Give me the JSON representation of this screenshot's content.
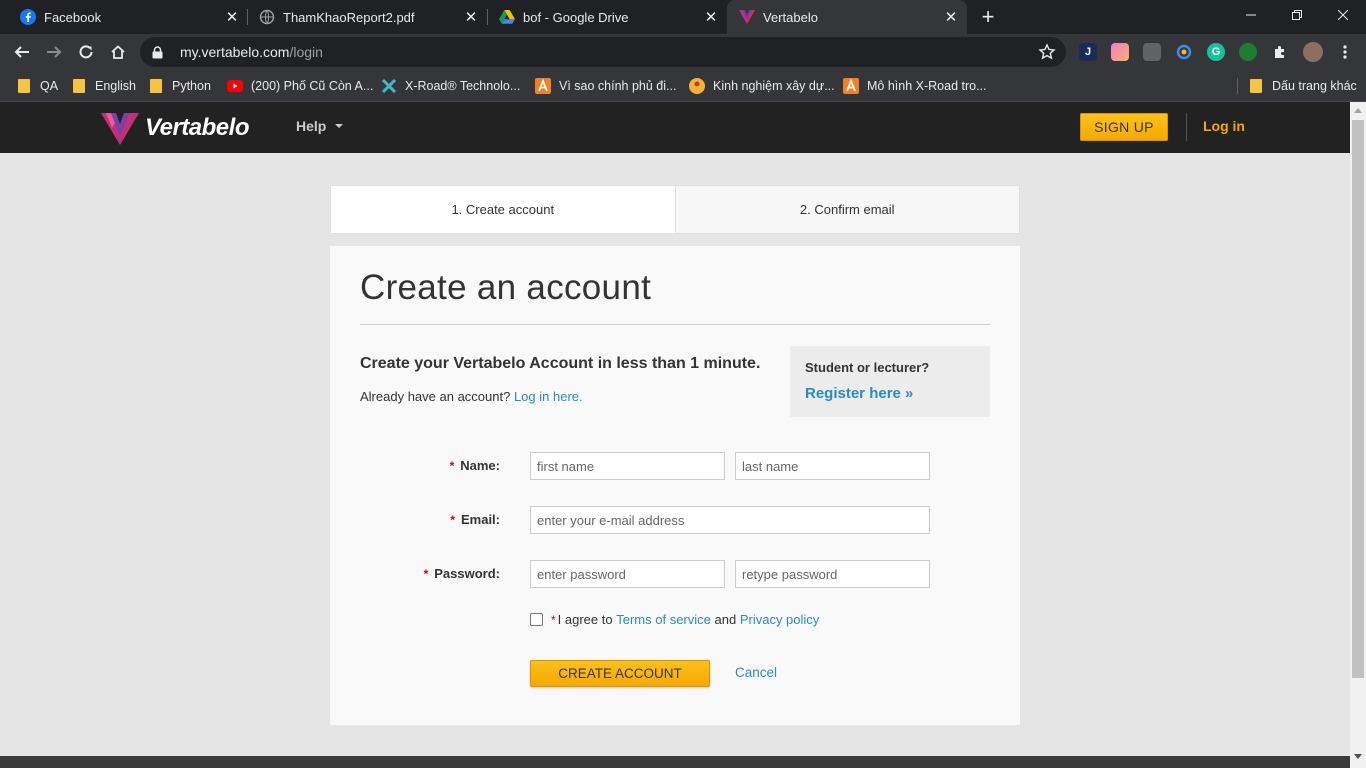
{
  "browser": {
    "tabs": [
      {
        "title": "Facebook",
        "icon": "facebook-icon",
        "close": "✕"
      },
      {
        "title": "ThamKhaoReport2.pdf",
        "icon": "globe-icon",
        "close": "✕"
      },
      {
        "title": "bof - Google Drive",
        "icon": "google-drive-icon",
        "close": "✕"
      },
      {
        "title": "Vertabelo",
        "icon": "vertabelo-icon",
        "close": "✕"
      }
    ],
    "new_tab": "+",
    "url_host": "my.vertabelo.com",
    "url_path": "/login",
    "bookmarks": [
      {
        "label": "QA",
        "icon": "folder-icon"
      },
      {
        "label": "English",
        "icon": "folder-icon"
      },
      {
        "label": "Python",
        "icon": "folder-icon"
      },
      {
        "label": "(200) Phố Cũ Còn A...",
        "icon": "youtube-icon"
      },
      {
        "label": "X-Road® Technolo...",
        "icon": "xroad-icon"
      },
      {
        "label": "Vì sao chính phủ đi...",
        "icon": "a-letter-icon"
      },
      {
        "label": "Kinh nghiệm xây dự...",
        "icon": "profile-icon"
      },
      {
        "label": "Mô hình X-Road tro...",
        "icon": "a-letter-icon"
      },
      {
        "label": "Dấu trang khác",
        "icon": "folder-icon"
      }
    ]
  },
  "site": {
    "logo_text": "Vertabelo",
    "help_label": "Help",
    "signup_label": "SIGN UP",
    "login_label": "Log in"
  },
  "steps": [
    "1. Create account",
    "2. Confirm email"
  ],
  "form": {
    "title": "Create an account",
    "lead": "Create your Vertabelo Account in less than 1 minute.",
    "already_text": "Already have an account?",
    "already_link": "Log in here.",
    "student_question": "Student or lecturer?",
    "student_link": "Register here »",
    "required_mark": "*",
    "name_label": "Name:",
    "email_label": "Email:",
    "password_label": "Password:",
    "first_name_placeholder": "first name",
    "last_name_placeholder": "last name",
    "email_placeholder": "enter your e-mail address",
    "password_placeholder": "enter password",
    "retype_placeholder": "retype password",
    "agree_prefix": "I agree to",
    "terms_link": "Terms of service",
    "and_text": "and",
    "privacy_link": "Privacy policy",
    "create_button": "CREATE ACCOUNT",
    "cancel_link": "Cancel"
  },
  "colors": {
    "accent": "#f5a900",
    "link": "#2a8bbe",
    "header_bg": "#222222"
  }
}
